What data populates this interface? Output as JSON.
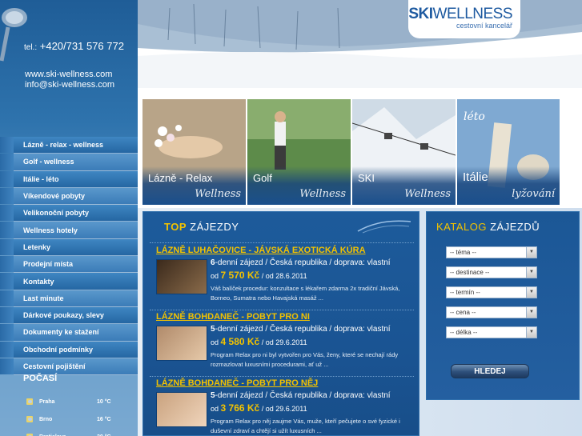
{
  "contact": {
    "tel_prefix": "tel.:",
    "tel": "+420/731 576 772",
    "web": "www.ski-wellness.com",
    "email": "info@ski-wellness.com"
  },
  "logo": {
    "main_bold": "SKI",
    "main_rest": "WELLNESS",
    "sub": "cestovní kancelář"
  },
  "nav": [
    "Lázně - relax - wellness",
    "Golf - wellness",
    "Itálie - léto",
    "Víkendové pobyty",
    "Velikonoční pobyty",
    "Wellness hotely",
    "Letenky",
    "Prodejní místa",
    "Kontakty",
    "Last minute",
    "Dárkové poukazy, slevy",
    "Dokumenty ke stažení",
    "Obchodní podmínky",
    "Cestovní pojištění"
  ],
  "weather": {
    "title": "POČASÍ",
    "rows": [
      {
        "city": "Praha",
        "temp": "10 °C"
      },
      {
        "city": "Brno",
        "temp": "16 °C"
      },
      {
        "city": "Bratislava",
        "temp": "20 °C"
      }
    ]
  },
  "promo": [
    {
      "label": "Lázně - Relax",
      "script": "Wellness"
    },
    {
      "label": "Golf",
      "script": "Wellness"
    },
    {
      "label": "SKI",
      "script": "Wellness"
    },
    {
      "label": "Itálie",
      "script": "lyžování",
      "top_script": "léto"
    }
  ],
  "top": {
    "title_a": "TOP",
    "title_b": "ZÁJEZDY",
    "items": [
      {
        "title": "LÁZNĚ LUHAČOVICE - JÁVSKÁ EXOTICKÁ KÚRA",
        "days": "6",
        "meta": "-denní zájezd / Česká republika / doprava: vlastní",
        "price_prefix": "od",
        "price": "7 570 Kč",
        "price_suffix": "/ od 28.6.2011",
        "desc": "Váš balíček procedur: konzultace s lékařem zdarma 2x tradiční Jávská, Borneo, Sumatra nebo Havajská masáž ..."
      },
      {
        "title": "LÁZNĚ BOHDANEČ - POBYT PRO NI",
        "days": "5",
        "meta": "-denní zájezd / Česká republika / doprava: vlastní",
        "price_prefix": "od",
        "price": "4 580 Kč",
        "price_suffix": "/ od 29.6.2011",
        "desc": "Program Relax pro ni byl vytvořen pro Vás, ženy, které se nechají rády rozmazlovat luxusními procedurami, ať už ..."
      },
      {
        "title": "LÁZNĚ BOHDANEČ - POBYT PRO NĚJ",
        "days": "5",
        "meta": "-denní zájezd / Česká republika / doprava: vlastní",
        "price_prefix": "od",
        "price": "3 766 Kč",
        "price_suffix": "/ od 29.6.2011",
        "desc": "Program Relax pro něj zaujme Vás, muže, kteří pečujete o své fyzické i duševní zdraví a chtějí si užít luxusních ..."
      }
    ]
  },
  "catalog": {
    "title_a": "KATALOG",
    "title_b": "ZÁJEZDŮ",
    "selects": [
      "-- téma --",
      "-- destinace --",
      "-- termín --",
      "-- cena --",
      "-- délka --"
    ],
    "search": "HLEDEJ"
  }
}
